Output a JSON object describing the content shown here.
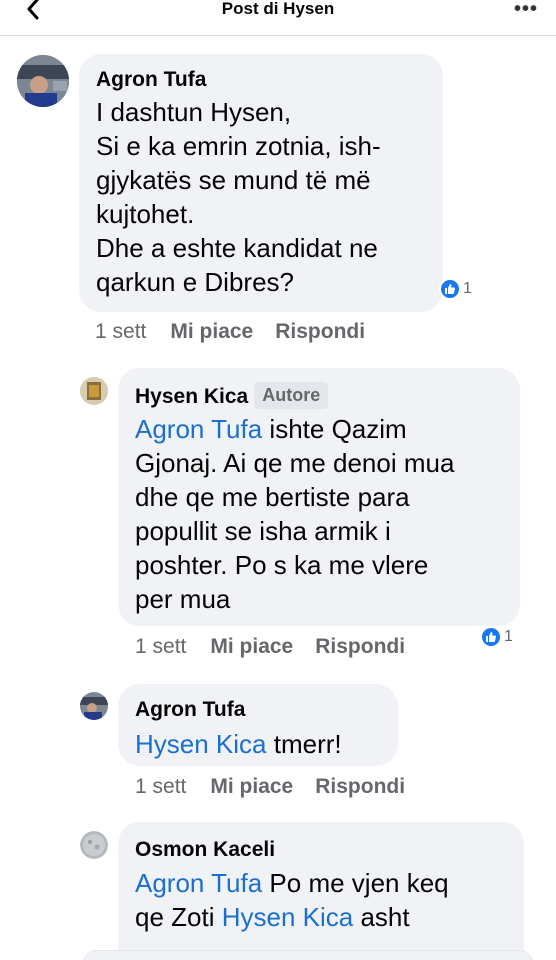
{
  "header": {
    "title": "Post di Hysen",
    "more_label": "•••"
  },
  "comments": [
    {
      "author": "Agron Tufa",
      "lines": [
        "I dashtun Hysen,",
        "Si e ka emrin zotnia, ish-",
        "gjykatës se mund të më",
        "kujtohet.",
        "Dhe a eshte kandidat ne",
        "qarkun e Dibres?"
      ],
      "time": "1 sett",
      "like": "Mi piace",
      "reply": "Rispondi",
      "reactions": "1"
    },
    {
      "author": "Hysen Kica",
      "badge": "Autore",
      "mention": "Agron Tufa",
      "lines": [
        " ishte Qazim",
        "Gjonaj. Ai qe me denoi mua",
        "dhe qe me bertiste para",
        "popullit se isha armik i",
        "poshter. Po s ka me vlere",
        "per mua"
      ],
      "time": "1 sett",
      "like": "Mi piace",
      "reply": "Rispondi",
      "reactions": "1"
    },
    {
      "author": "Agron Tufa",
      "mention": "Hysen Kica",
      "text": " tmerr!",
      "time": "1 sett",
      "like": "Mi piace",
      "reply": "Rispondi"
    },
    {
      "author": "Osmon Kaceli",
      "mention": "Agron Tufa",
      "text1": " Po me vjen keq",
      "text2_pre": "qe Zoti ",
      "mention2": "Hysen Kica",
      "text2_post": " asht"
    }
  ]
}
